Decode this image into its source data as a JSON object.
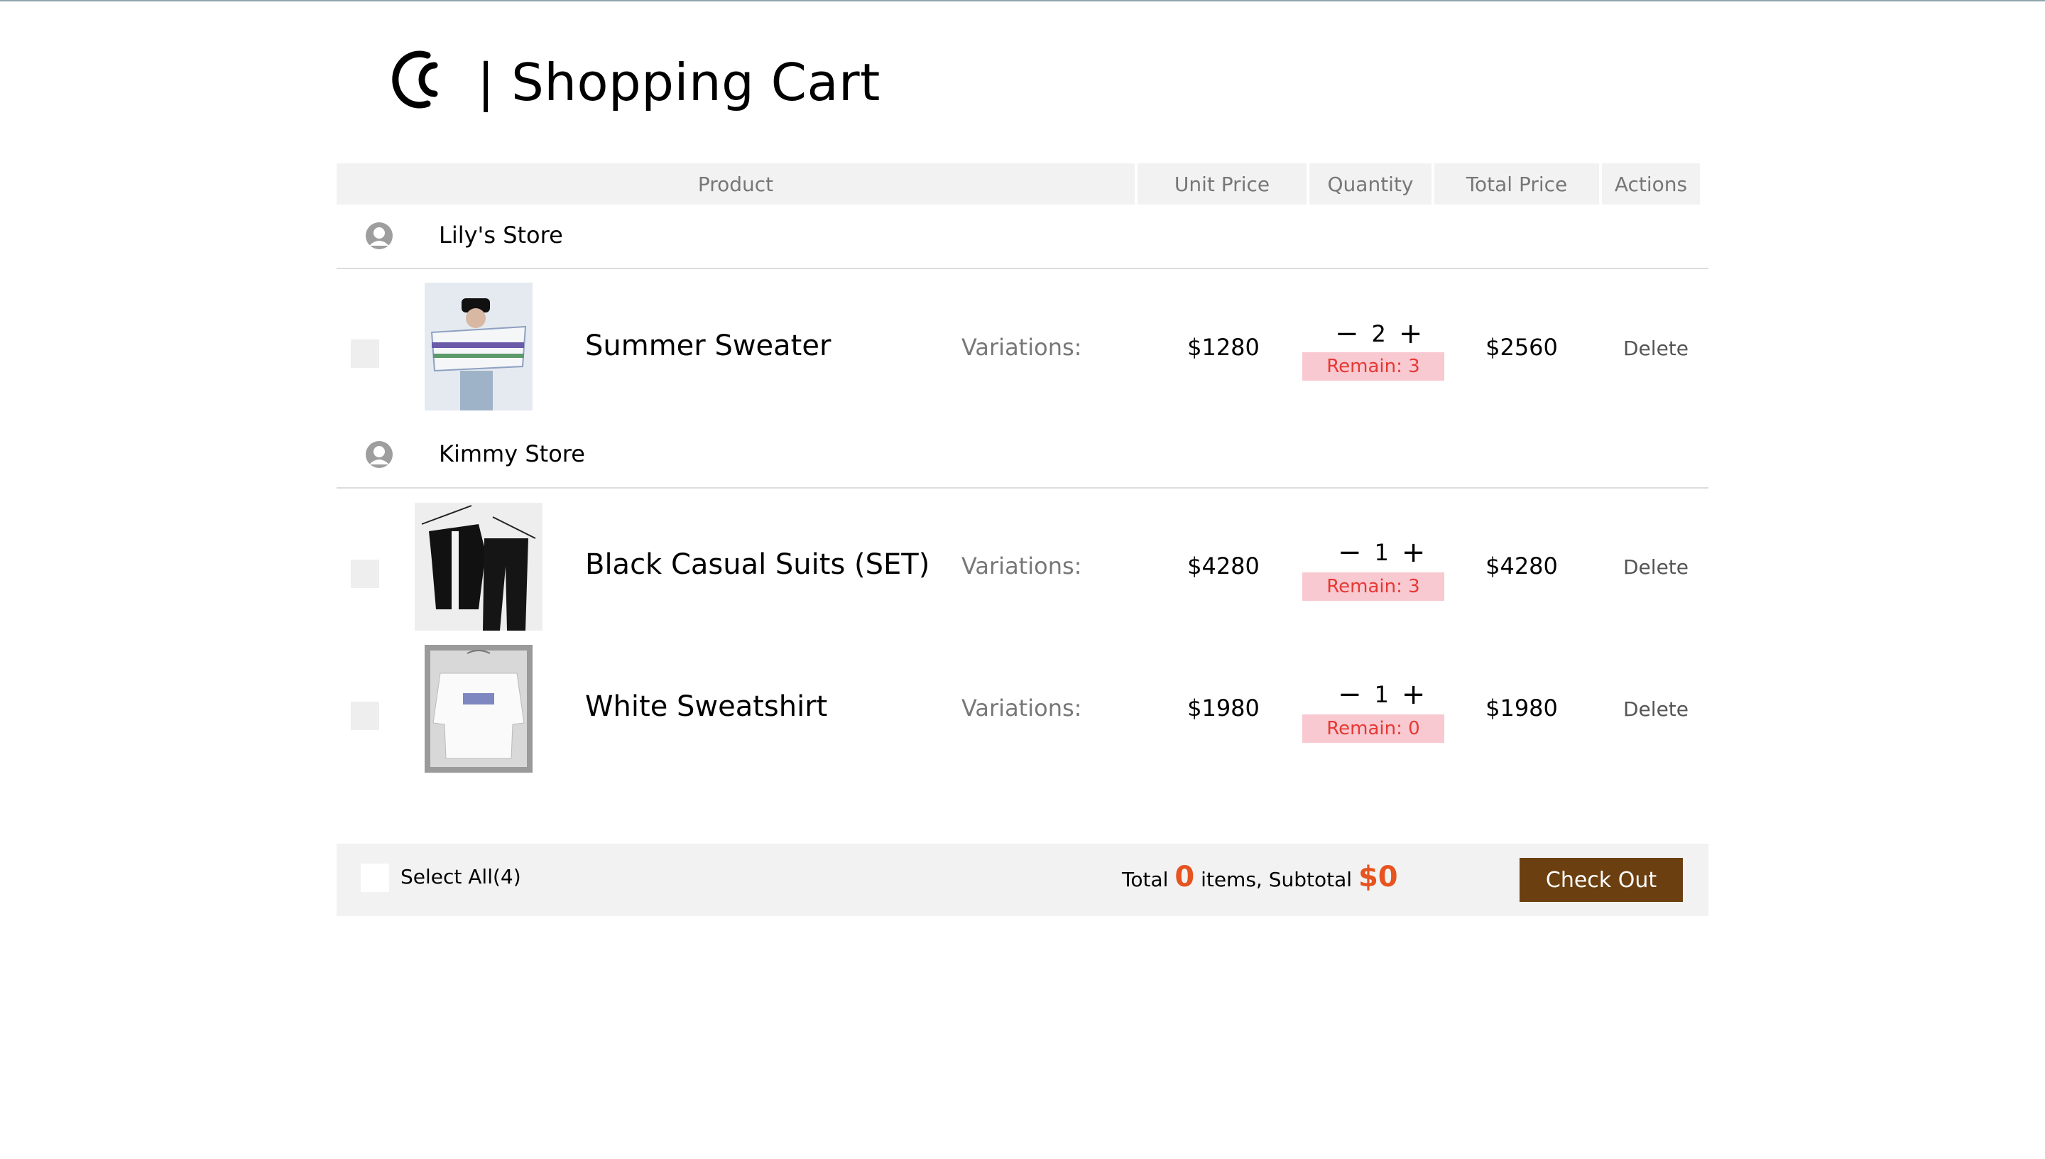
{
  "header": {
    "title": "| Shopping Cart",
    "logo_icon": "c-logo-icon"
  },
  "columns": [
    "Product",
    "Unit Price",
    "Quantity",
    "Total Price",
    "Actions"
  ],
  "stores": [
    {
      "name": "Lily's Store",
      "items": [
        {
          "name": "Summer Sweater",
          "variations": "Variations:",
          "unit_price": "$1280",
          "quantity": "2",
          "remain": "Remain: 3",
          "total": "$2560",
          "action": "Delete"
        }
      ]
    },
    {
      "name": "Kimmy Store",
      "items": [
        {
          "name": "Black Casual Suits (SET)",
          "variations": "Variations:",
          "unit_price": "$4280",
          "quantity": "1",
          "remain": "Remain: 3",
          "total": "$4280",
          "action": "Delete"
        },
        {
          "name": "White Sweatshirt",
          "variations": "Variations:",
          "unit_price": "$1980",
          "quantity": "1",
          "remain": "Remain: 0",
          "total": "$1980",
          "action": "Delete"
        }
      ]
    }
  ],
  "qty_controls": {
    "minus": "−",
    "plus": "+"
  },
  "footer": {
    "select_all": "Select All(4)",
    "total_prefix": "Total",
    "item_count": "0",
    "items_mid": "items, Subtotal",
    "subtotal": "$0",
    "checkout": "Check Out"
  },
  "colors": {
    "accent": "#e6541f",
    "checkout_bg": "#6b3f10",
    "remain_bg": "#f8c9d0",
    "remain_text": "#e53935"
  }
}
